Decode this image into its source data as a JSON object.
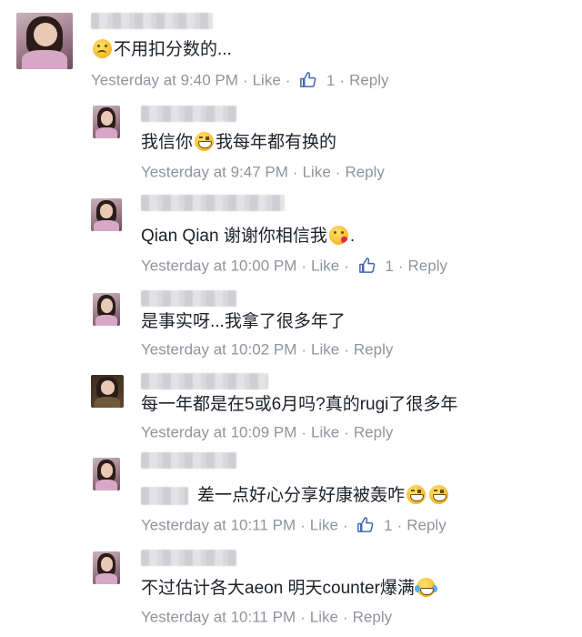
{
  "comments": [
    {
      "text_before": "",
      "text": "不用扣分数的...",
      "emoji": "disappointed-face",
      "time": "Yesterday at 9:40 PM",
      "like": "Like",
      "like_count": "1",
      "reply": "Reply"
    },
    {
      "text_before": "我信你",
      "text": "我每年都有换的",
      "emoji": "grinning-squinting-face",
      "time": "Yesterday at 9:47 PM",
      "like": "Like",
      "reply": "Reply"
    },
    {
      "text": "Qian Qian  谢谢你相信我",
      "text_after": ".",
      "emoji": "face-blowing-kiss",
      "time": "Yesterday at 10:00 PM",
      "like": "Like",
      "like_count": "1",
      "reply": "Reply"
    },
    {
      "text": "是事实呀...我拿了很多年了",
      "time": "Yesterday at 10:02 PM",
      "like": "Like",
      "reply": "Reply"
    },
    {
      "text": "每一年都是在5或6月吗?真的rugi了很多年",
      "time": "Yesterday at 10:09 PM",
      "like": "Like",
      "reply": "Reply"
    },
    {
      "text": "差一点好心分享好康被轰咋",
      "emoji": "grinning-face-with-big-eyes",
      "time": "Yesterday at 10:11 PM",
      "like": "Like",
      "like_count": "1",
      "reply": "Reply"
    },
    {
      "text": "不过估计各大aeon 明天counter爆满",
      "emoji": "face-with-tears-of-joy",
      "time": "Yesterday at 10:11 PM",
      "like": "Like",
      "reply": "Reply"
    }
  ],
  "colors": {
    "text": "#1d2129",
    "meta": "#90949c",
    "like_icon": "#4267b2"
  }
}
